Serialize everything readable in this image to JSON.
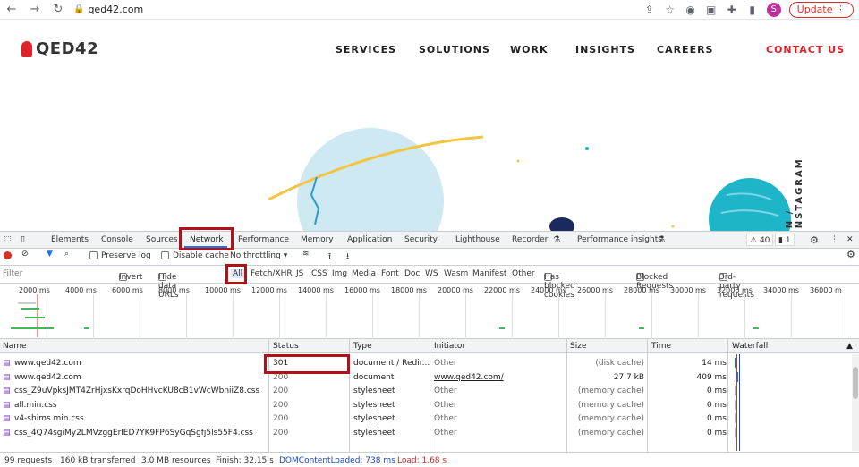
{
  "browser": {
    "url": "qed42.com",
    "update_label": "Update",
    "avatar": "S"
  },
  "site": {
    "logo": "QED42",
    "nav": [
      "SERVICES",
      "SOLUTIONS",
      "WORK",
      "INSIGHTS",
      "CAREERS",
      "CONTACT US"
    ],
    "social": "IN / INSTAGRAM",
    "contact_color": "#e0232a"
  },
  "devtools": {
    "tabs": [
      "Elements",
      "Console",
      "Sources",
      "Network",
      "Performance",
      "Memory",
      "Application",
      "Security",
      "Lighthouse",
      "Recorder",
      "Performance insights"
    ],
    "warnings": "40",
    "issues": "1",
    "toolbar": {
      "preserve_log": "Preserve log",
      "disable_cache": "Disable cache",
      "throttling": "No throttling"
    },
    "filter": {
      "placeholder": "Filter",
      "invert": "Invert",
      "hide_data": "Hide data URLs",
      "types": [
        "All",
        "Fetch/XHR",
        "JS",
        "CSS",
        "Img",
        "Media",
        "Font",
        "Doc",
        "WS",
        "Wasm",
        "Manifest",
        "Other"
      ],
      "blocked_cookies": "Has blocked cookies",
      "blocked_requests": "Blocked Requests",
      "third_party": "3rd-party requests"
    },
    "overview_ticks": [
      "2000 ms",
      "4000 ms",
      "6000 ms",
      "8000 ms",
      "10000 ms",
      "12000 ms",
      "14000 ms",
      "16000 ms",
      "18000 ms",
      "20000 ms",
      "22000 ms",
      "24000 ms",
      "26000 ms",
      "28000 ms",
      "30000 ms",
      "32000 ms",
      "34000 ms",
      "36000 m"
    ],
    "columns": [
      "Name",
      "Status",
      "Type",
      "Initiator",
      "Size",
      "Time",
      "Waterfall"
    ],
    "rows": [
      {
        "name": "www.qed42.com",
        "status": "301",
        "type": "document / Redir...",
        "initiator": "Other",
        "size": "(disk cache)",
        "time": "14 ms"
      },
      {
        "name": "www.qed42.com",
        "status": "200",
        "type": "document",
        "initiator": "www.qed42.com/",
        "size": "27.7 kB",
        "time": "409 ms"
      },
      {
        "name": "css_Z9uVpksJMT4ZrHjxsKxrqDoHHvcKU8cB1vWcWbniiZ8.css",
        "status": "200",
        "type": "stylesheet",
        "initiator": "Other",
        "size": "(memory cache)",
        "time": "0 ms"
      },
      {
        "name": "all.min.css",
        "status": "200",
        "type": "stylesheet",
        "initiator": "Other",
        "size": "(memory cache)",
        "time": "0 ms"
      },
      {
        "name": "v4-shims.min.css",
        "status": "200",
        "type": "stylesheet",
        "initiator": "Other",
        "size": "(memory cache)",
        "time": "0 ms"
      },
      {
        "name": "css_4Q74sgiMy2LMVzggErlED7YK9FP6SyGqSgfj5ls55F4.css",
        "status": "200",
        "type": "stylesheet",
        "initiator": "Other",
        "size": "(memory cache)",
        "time": "0 ms"
      }
    ],
    "status_bar": {
      "requests": "99 requests",
      "transferred": "160 kB transferred",
      "resources": "3.0 MB resources",
      "finish": "Finish: 32.15 s",
      "dom": "DOMContentLoaded: 738 ms",
      "load": "Load: 1.68 s"
    }
  }
}
